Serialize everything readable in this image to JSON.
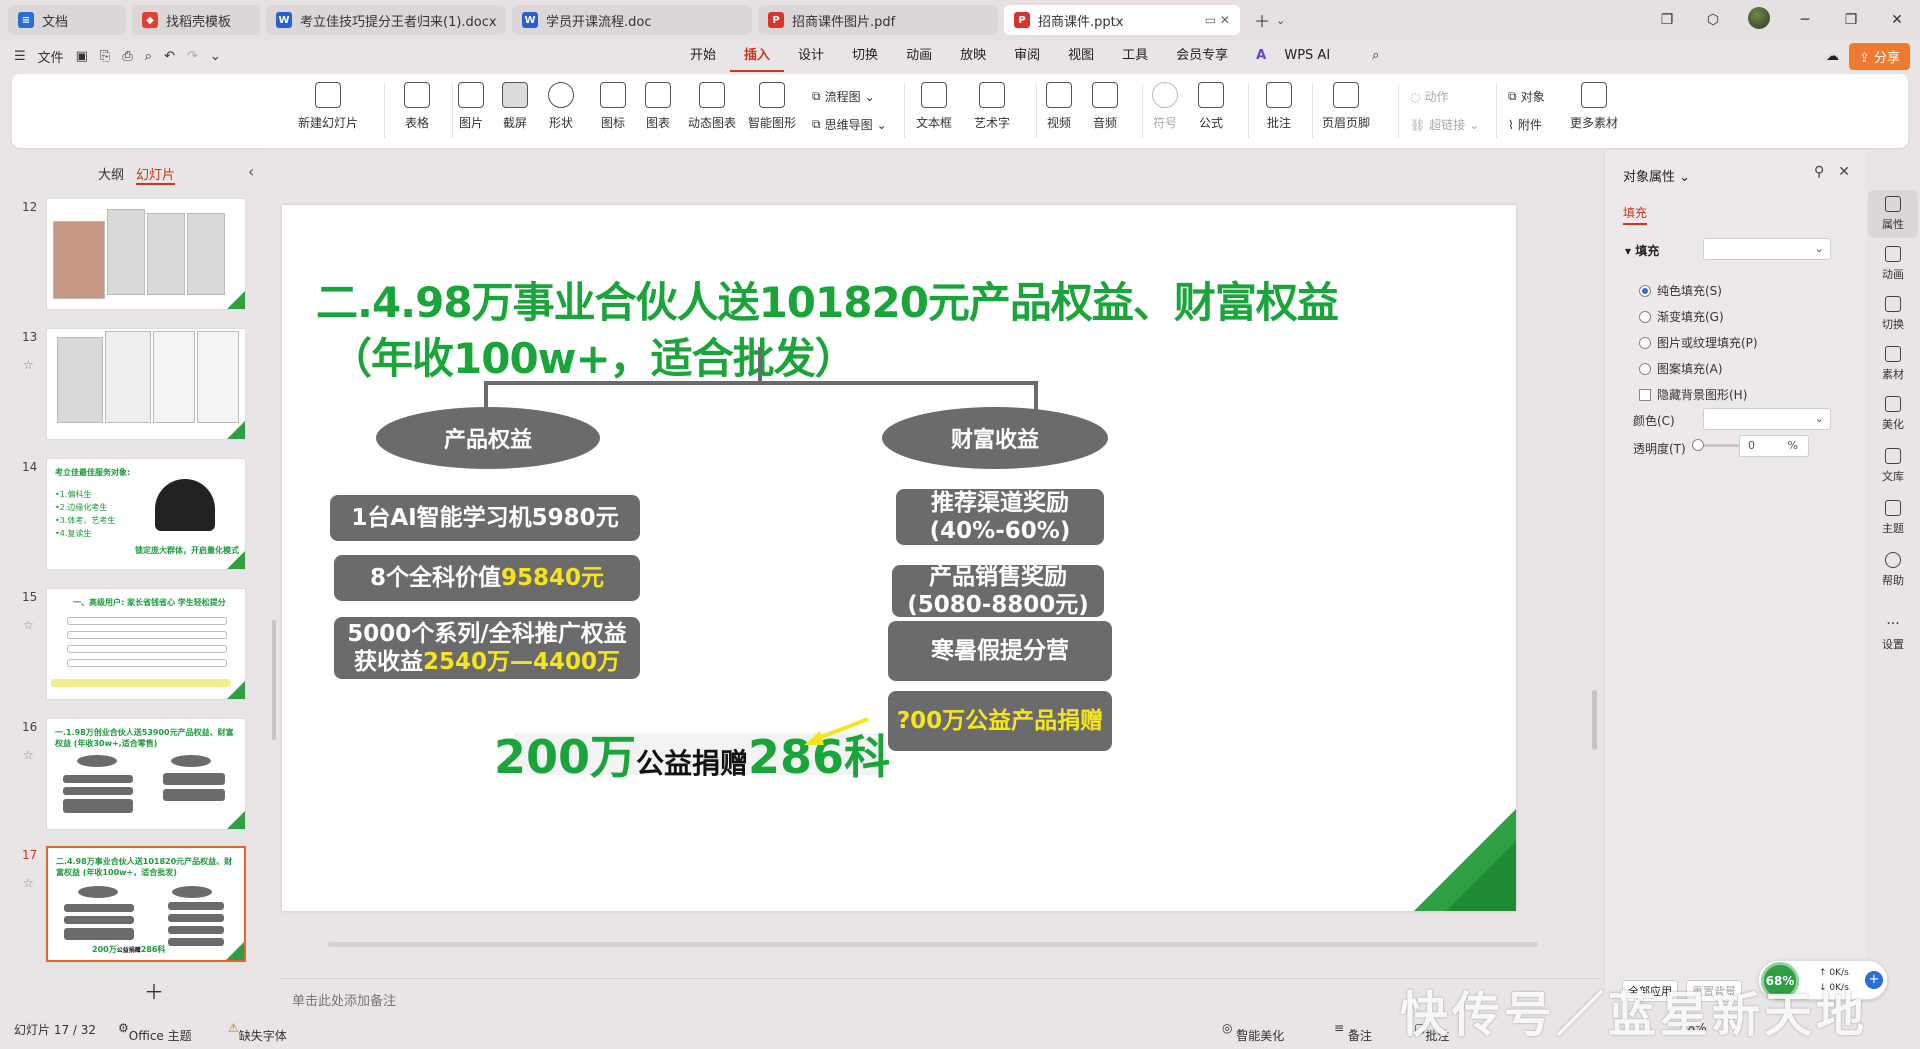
{
  "tabs": [
    {
      "label": "文档",
      "icon": "wps-doc-icon",
      "color": "#2a6fd6",
      "glyph": "≡"
    },
    {
      "label": "找稻壳模板",
      "icon": "docer-icon",
      "color": "#e0432b",
      "glyph": "◆"
    },
    {
      "label": "考立佳技巧提分王者归来(1).docx",
      "icon": "word-icon",
      "color": "#2a5fd0",
      "glyph": "W"
    },
    {
      "label": "学员开课流程.doc",
      "icon": "word-icon",
      "color": "#2a5fd0",
      "glyph": "W"
    },
    {
      "label": "招商课件图片.pdf",
      "icon": "pdf-icon",
      "color": "#d9342b",
      "glyph": "P"
    },
    {
      "label": "招商课件.pptx",
      "icon": "ppt-icon",
      "color": "#d9342b",
      "glyph": "P",
      "active": true
    }
  ],
  "menu": {
    "file": "文件",
    "items": [
      "开始",
      "插入",
      "设计",
      "切换",
      "动画",
      "放映",
      "审阅",
      "视图",
      "工具",
      "会员专享"
    ],
    "active": "插入",
    "wps_ai": "WPS AI",
    "share": "分享"
  },
  "ribbon": {
    "new_slide": "新建幻灯片",
    "table": "表格",
    "picture": "图片",
    "screenshot": "截屏",
    "shape": "形状",
    "icon": "图标",
    "chart": "图表",
    "dynamic_chart": "动态图表",
    "smart_shape": "智能图形",
    "flowchart": "流程图",
    "mindmap": "思维导图",
    "textbox": "文本框",
    "art_text": "艺术字",
    "video": "视频",
    "audio": "音频",
    "symbol": "符号",
    "formula": "公式",
    "comment": "批注",
    "header_footer": "页眉页脚",
    "action": "动作",
    "hyperlink": "超链接",
    "object": "对象",
    "attachment": "附件",
    "more": "更多素材"
  },
  "left_panel": {
    "outline": "大纲",
    "slides": "幻灯片",
    "thumbs": [
      {
        "num": "12"
      },
      {
        "num": "13"
      },
      {
        "num": "14",
        "title": "考立佳最佳服务对象:",
        "lines": [
          "•1.偏科生",
          "•2.边缘化考生",
          "•3.体考、艺考生",
          "•4.复读生"
        ],
        "caption": "锁定庞大群体，开启量化模式"
      },
      {
        "num": "15",
        "title": "一、高级用户: 家长省钱省心 学生轻松提分"
      },
      {
        "num": "16",
        "title": "一.1.98万创业合伙人送53900元产品权益、财富权益 (年收30w+,适合零售)"
      },
      {
        "num": "17",
        "title": "二.4.98万事业合伙人送101820元产品权益、财富权益 (年收100w+，适合批发)",
        "active": true
      }
    ]
  },
  "slide": {
    "title_line1": "二.4.98万事业合伙人送101820元产品权益、财富权益",
    "title_line2": "（年收100w+，适合批发）",
    "left_head": "产品权益",
    "right_head": "财富收益",
    "left_boxes": [
      {
        "text": "1台AI智能学习机5980元",
        "hl": ""
      },
      {
        "text": "8个全科价值",
        "hl": "95840元"
      },
      {
        "line1": "5000个系列/全科推广权益",
        "line2": "获收益",
        "hl": "2540万—4400万"
      }
    ],
    "right_boxes": [
      {
        "line1": "推荐渠道奖励",
        "line2": "(40%-60%)"
      },
      {
        "line1": "产品销售奖励",
        "line2": "(5080-8800元)"
      },
      {
        "line1": "寒暑假提分营"
      },
      {
        "line1": "?00万公益产品捐赠"
      }
    ],
    "bottom_big1": "200万",
    "bottom_small": "公益捐赠",
    "bottom_big2": "286科"
  },
  "notes_placeholder": "单击此处添加备注",
  "right_panel": {
    "title": "对象属性",
    "tab": "填充",
    "section": "填充",
    "options": [
      "纯色填充(S)",
      "渐变填充(G)",
      "图片或纹理填充(P)",
      "图案填充(A)"
    ],
    "checkbox": "隐藏背景图形(H)",
    "color_label": "颜色(C)",
    "transparency_label": "透明度(T)",
    "transparency_value": "0",
    "percent": "%"
  },
  "rail": [
    "属性",
    "动画",
    "切换",
    "素材",
    "美化",
    "文库",
    "主题",
    "帮助",
    "设置"
  ],
  "status": {
    "slide_pos": "幻灯片 17 / 32",
    "theme": "Office 主题",
    "missing_font": "缺失字体",
    "beautify": "智能美化",
    "notes": "备注",
    "comment": "批注",
    "zoom": "98%",
    "full_apply": "全部应用",
    "reset_bg": "重置背景"
  },
  "network": {
    "percent": "68%",
    "up": "0K/s",
    "down": "0K/s"
  },
  "watermark": "快传号／蓝星新天地",
  "colors": {
    "accent": "#c7381f",
    "green": "#1aa53a",
    "box": "#6b6b6b",
    "yellow": "#f5e51c"
  }
}
